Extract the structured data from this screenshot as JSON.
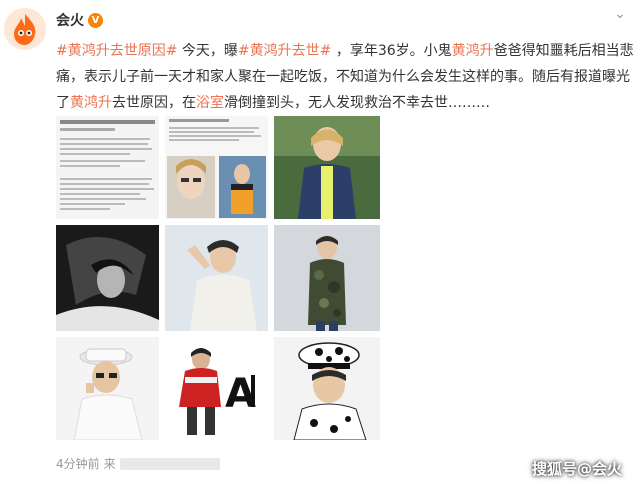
{
  "user": {
    "name": "会火",
    "verified_mark": "V"
  },
  "post": {
    "segments": [
      {
        "t": "#黄鸿升去世原因#",
        "c": "tag"
      },
      {
        "t": " 今天，曝",
        "c": ""
      },
      {
        "t": "#黄鸿升去世#",
        "c": "tag"
      },
      {
        "t": " ，享年36岁。小鬼",
        "c": ""
      },
      {
        "t": "黄鸿升",
        "c": "hl"
      },
      {
        "t": "爸爸得知噩耗后相当悲痛，表示儿子前一天才和家人聚在一起吃饭，不知道为什么会发生这样的事。随后有报道曝光了",
        "c": ""
      },
      {
        "t": "黄鸿升",
        "c": "hl"
      },
      {
        "t": "去世原因，在",
        "c": ""
      },
      {
        "t": "浴室",
        "c": "hl"
      },
      {
        "t": "滑倒撞到头，无人发现救治不幸去世………",
        "c": ""
      }
    ]
  },
  "photos": [
    {
      "label": "news-article-1"
    },
    {
      "label": "news-article-2"
    },
    {
      "label": "photo-cardigan"
    },
    {
      "label": "photo-bw-hair"
    },
    {
      "label": "photo-white-jacket"
    },
    {
      "label": "photo-camo-jacket"
    },
    {
      "label": "photo-white-cap"
    },
    {
      "label": "photo-ali3"
    },
    {
      "label": "photo-sailor-hat"
    }
  ],
  "footer": {
    "time": "4分钟前",
    "source_prefix": "来"
  },
  "watermark": "搜狐号@会火",
  "colors": {
    "accent": "#eb7350",
    "vip": "#ff8200",
    "muted": "#999999"
  }
}
